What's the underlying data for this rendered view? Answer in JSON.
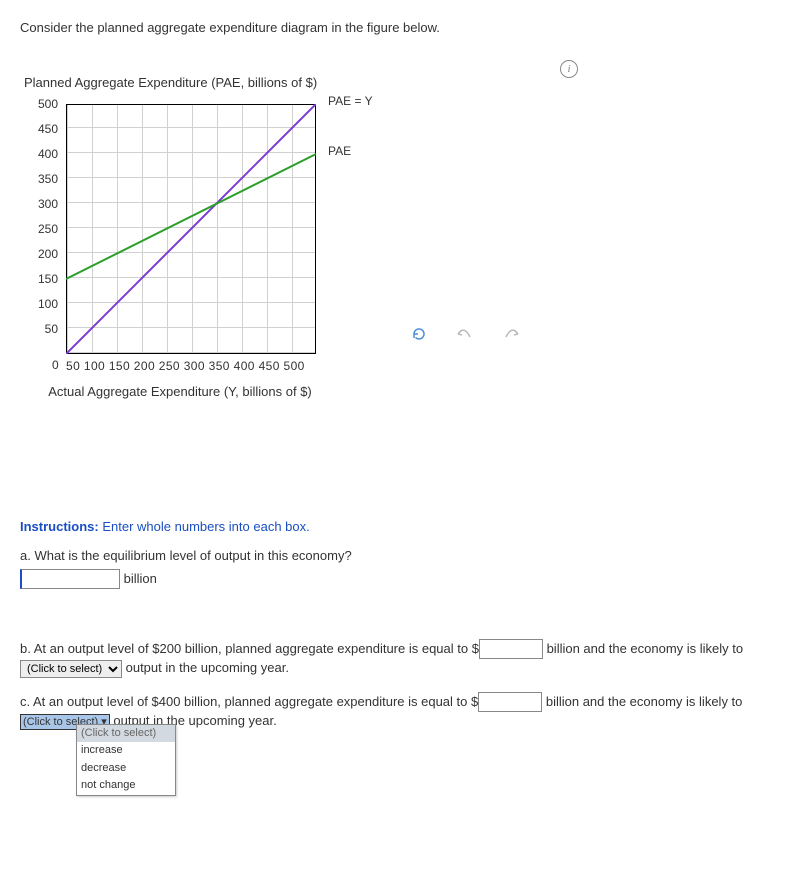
{
  "intro": "Consider the planned aggregate expenditure diagram in the figure below.",
  "chart_title": "Planned Aggregate Expenditure (PAE, billions of $)",
  "x_axis_label": "Actual Aggregate Expenditure (Y, billions of $)",
  "line_labels": {
    "pae_y": "PAE = Y",
    "pae": "PAE"
  },
  "y_ticks": [
    "500",
    "450",
    "400",
    "350",
    "300",
    "250",
    "200",
    "150",
    "100",
    "50"
  ],
  "x_ticks": "50 100 150 200 250 300 350 400 450 500",
  "origin": "0",
  "chart_data": {
    "type": "line",
    "xlabel": "Actual Aggregate Expenditure (Y, billions of $)",
    "ylabel": "Planned Aggregate Expenditure (PAE, billions of $)",
    "xlim": [
      0,
      500
    ],
    "ylim": [
      0,
      500
    ],
    "series": [
      {
        "name": "PAE = Y",
        "x": [
          0,
          500
        ],
        "y": [
          0,
          500
        ]
      },
      {
        "name": "PAE",
        "x": [
          0,
          500
        ],
        "y": [
          150,
          400
        ]
      }
    ]
  },
  "instructions_label": "Instructions:",
  "instructions_text": " Enter whole numbers into each box.",
  "qa": {
    "a_label": "a.  What is the equilibrium level of output in this economy?",
    "a_value": "",
    "a_unit": "billion"
  },
  "qb": {
    "pre": "b.  At an output level of $200 billion, planned aggregate expenditure is equal to $",
    "value": "",
    "mid": " billion and the economy is likely to ",
    "select": "(Click to select)",
    "post": " output in the upcoming year."
  },
  "qc": {
    "pre": "c.  At an output level of $400 billion, planned aggregate expenditure is equal to $",
    "value": "",
    "mid": " billion and the economy is likely to ",
    "select": "(Click to select)",
    "post": " output in the upcoming year."
  },
  "dropdown": {
    "header": "(Click to select)",
    "opt1": "increase",
    "opt2": "decrease",
    "opt3": "not change"
  }
}
